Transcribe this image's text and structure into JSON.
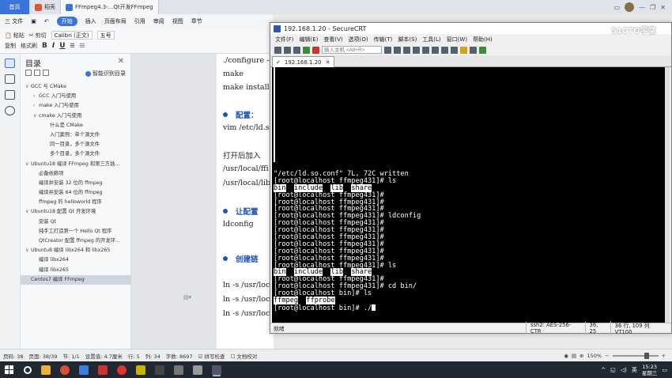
{
  "wps_tabs": {
    "home": "首页",
    "straw": "稻壳",
    "doc": "FFmpeg4.3-...Qt开发FFmpeg"
  },
  "wps_menu": {
    "file": "三 文件",
    "start": "开始",
    "insert": "插入",
    "layout": "页面布局",
    "reference": "引用",
    "review": "审阅",
    "view": "视图",
    "chapter": "章节"
  },
  "ribbon": {
    "paste": "粘贴",
    "cut": "剪切",
    "copy": "复制",
    "format_painter": "格式刷",
    "font_name": "Calibri (正文)",
    "font_size": "五号",
    "bold": "B",
    "italic": "I",
    "underline": "U"
  },
  "toc": {
    "title": "目录",
    "smart_label": "智能识别目录",
    "items": [
      {
        "label": "GCC 与 CMake",
        "level": 1,
        "caret": "∨"
      },
      {
        "label": "GCC 入门与使用",
        "level": 2,
        "caret": "›"
      },
      {
        "label": "make 入门与使用",
        "level": 2,
        "caret": "›"
      },
      {
        "label": "cmake 入门与使用",
        "level": 2,
        "caret": "∨"
      },
      {
        "label": "什么是 CMake",
        "level": 3,
        "caret": ""
      },
      {
        "label": "入门案例：单个源文件",
        "level": 3,
        "caret": ""
      },
      {
        "label": "同一目录，多个源文件",
        "level": 3,
        "caret": ""
      },
      {
        "label": "多个目录，多个源文件",
        "level": 3,
        "caret": ""
      },
      {
        "label": "Ubuntu18 编译 FFmpeg 和第三方插...",
        "level": 1,
        "caret": "∨"
      },
      {
        "label": "必备依赖项",
        "level": 2,
        "caret": ""
      },
      {
        "label": "编译并安装 32 位的 ffmpeg",
        "level": 2,
        "caret": ""
      },
      {
        "label": "编译并安装 64 位的 ffmpeg",
        "level": 2,
        "caret": ""
      },
      {
        "label": "ffmpeg 的 helloworld 程序",
        "level": 2,
        "caret": ""
      },
      {
        "label": "Ubuntu18 配置 Qt 开发环境",
        "level": 1,
        "caret": "∨"
      },
      {
        "label": "安装 Qt",
        "level": 2,
        "caret": ""
      },
      {
        "label": "纯手工打造第一个 Hello Qt 程序",
        "level": 2,
        "caret": ""
      },
      {
        "label": "QtCreator 配置 ffmpeg 的开发环...",
        "level": 2,
        "caret": ""
      },
      {
        "label": "Ubuntu8 编译 libx264 和 libx265",
        "level": 1,
        "caret": "∨"
      },
      {
        "label": "编译 libx264",
        "level": 2,
        "caret": ""
      },
      {
        "label": "编译 libx265",
        "level": 2,
        "caret": ""
      },
      {
        "label": "Centos7 编译 FFmpeg",
        "level": 1,
        "caret": "",
        "selected": true
      }
    ]
  },
  "doc": {
    "line1": "./configure --",
    "line2": "make",
    "line3": "make install",
    "config_heading": "配置：",
    "vim_line": "vim /etc/ld.s",
    "open_line": "打开后加入",
    "path1": "/usr/local/ffi",
    "path2": "/usr/local/lib",
    "make_heading": "让配置",
    "ldconfig": "ldconfig",
    "link_heading": "创建链",
    "ln1": "ln -s /usr/loc",
    "ln2": "ln -s /usr/loc",
    "ln3": "ln -s /usr/loc"
  },
  "crt": {
    "title": "192.168.1.20 - SecureCRT",
    "menu": [
      "文件(F)",
      "编辑(E)",
      "查看(V)",
      "选项(O)",
      "传输(T)",
      "脚本(S)",
      "工具(L)",
      "窗口(W)",
      "帮助(H)"
    ],
    "host_placeholder": "输入主机 <Alt+R>",
    "tab_label": "192.168.1.20",
    "lines": [
      {
        "text": "\"/etc/ld.so.conf\" 7L, 72C written"
      },
      {
        "text": "[root@localhost ffmpeg431]# ls"
      },
      {
        "segments": [
          "bin",
          "include",
          "lib",
          "share"
        ],
        "highlight": true
      },
      {
        "text": "[root@localhost ffmpeg431]#"
      },
      {
        "text": "[root@localhost ffmpeg431]#"
      },
      {
        "text": "[root@localhost ffmpeg431]#"
      },
      {
        "text": "[root@localhost ffmpeg431]# ldconfig"
      },
      {
        "text": "[root@localhost ffmpeg431]#"
      },
      {
        "text": "[root@localhost ffmpeg431]#"
      },
      {
        "text": "[root@localhost ffmpeg431]#"
      },
      {
        "text": "[root@localhost ffmpeg431]#"
      },
      {
        "text": "[root@localhost ffmpeg431]#"
      },
      {
        "text": "[root@localhost ffmpeg431]#"
      },
      {
        "text": "[root@localhost ffmpeg431]# ls"
      },
      {
        "segments": [
          "bin",
          "include",
          "lib",
          "share"
        ],
        "highlight": true
      },
      {
        "text": "[root@localhost ffmpeg431]#"
      },
      {
        "text": "[root@localhost ffmpeg431]# cd bin/"
      },
      {
        "text": "[root@localhost bin]# ls"
      },
      {
        "segments": [
          "ffmpeg",
          "ffprobe"
        ],
        "highlight": true
      },
      {
        "text": "[root@localhost bin]# ./",
        "cursor": true
      }
    ],
    "status_ready": "就绪",
    "status_cipher": "ssh2: AES-256-CTR",
    "status_pos": "36, 25",
    "status_size": "36 行, 109 列 VT100"
  },
  "watermark": "51CTO学堂",
  "wps_status": {
    "page": "页码: 38",
    "pages": "页面: 38/39",
    "section": "节: 1/1",
    "setting": "设置值: 4.7厘米",
    "row": "行: 5",
    "col": "列: 34",
    "words": "字数: 8697",
    "spell": "拼写检查",
    "proof": "文档校对",
    "zoom": "150%"
  },
  "taskbar": {
    "time": "15:23",
    "day": "星期三",
    "lang": "英"
  }
}
